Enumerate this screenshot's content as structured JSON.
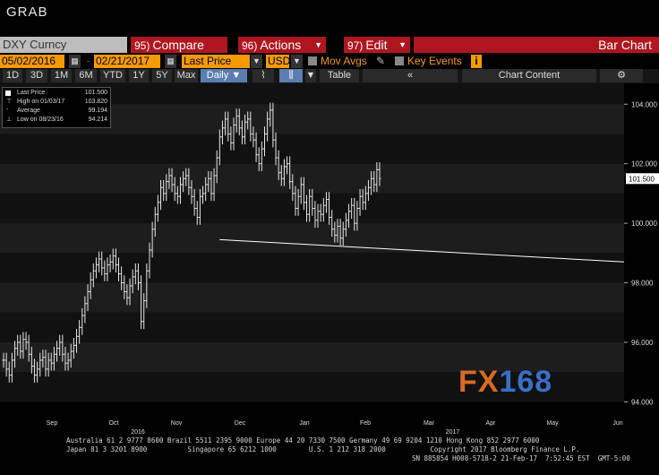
{
  "header": {
    "title": "GRAB"
  },
  "toolbar": {
    "ticker": "DXY Curncy",
    "compare": {
      "num": "95)",
      "label": "Compare"
    },
    "actions": {
      "num": "96)",
      "label": "Actions"
    },
    "edit": {
      "num": "97)",
      "label": "Edit"
    },
    "chart_type": "Bar Chart"
  },
  "settings": {
    "start_date": "05/02/2016",
    "end_date": "02/21/2017",
    "price_field": "Last Price",
    "currency": "USD",
    "mov_avgs": "Mov Avgs",
    "key_events": "Key Events",
    "key_events_icon": "i"
  },
  "periods": [
    "1D",
    "3D",
    "1M",
    "6M",
    "YTD",
    "1Y",
    "5Y",
    "Max"
  ],
  "frequency": "Daily",
  "table_label": "Table",
  "chart_content_label": "Chart Content",
  "legend": {
    "last_price_label": "Last Price",
    "last_price_value": "101.500",
    "high_label": "High on 01/03/17",
    "high_value": "103.820",
    "average_label": "Average",
    "average_value": "99.194",
    "low_label": "Low on 08/23/16",
    "low_value": "94.214"
  },
  "chart_data": {
    "type": "bar",
    "y_ticks": [
      "104.000",
      "102.000",
      "100.000",
      "98.000",
      "96.000",
      "94.000"
    ],
    "y_range": [
      93.5,
      104.7
    ],
    "last_price_tag": "101.500",
    "month_labels": [
      "Sep",
      "Oct",
      "Nov",
      "Dec",
      "Jan",
      "Feb",
      "Mar",
      "Apr",
      "May",
      "Jun"
    ],
    "year_labels": [
      {
        "label": "2016",
        "after": "Oct"
      },
      {
        "label": "2017",
        "after": "Mar"
      }
    ],
    "closes": [
      95.4,
      95.1,
      94.9,
      95.4,
      95.8,
      96.0,
      95.7,
      96.1,
      96.0,
      95.6,
      95.2,
      94.9,
      95.1,
      95.4,
      95.5,
      95.1,
      95.4,
      95.3,
      95.6,
      95.8,
      96.0,
      95.6,
      95.3,
      95.4,
      95.7,
      95.9,
      96.2,
      96.5,
      96.9,
      97.3,
      97.7,
      98.1,
      98.4,
      98.6,
      98.8,
      98.5,
      98.3,
      98.6,
      98.7,
      98.9,
      98.6,
      98.3,
      98.0,
      97.7,
      97.5,
      97.9,
      98.2,
      98.4,
      98.0,
      96.7,
      97.4,
      98.4,
      99.1,
      99.8,
      100.3,
      100.7,
      101.2,
      101.0,
      101.4,
      101.6,
      101.3,
      101.0,
      100.9,
      101.3,
      101.5,
      101.6,
      101.2,
      100.9,
      100.5,
      100.2,
      100.9,
      101.0,
      101.3,
      101.5,
      101.0,
      101.6,
      102.2,
      102.9,
      103.2,
      103.5,
      103.0,
      102.7,
      103.3,
      103.6,
      103.2,
      102.9,
      103.4,
      103.5,
      103.0,
      102.8,
      102.3,
      102.0,
      102.5,
      103.0,
      103.5,
      103.8,
      102.8,
      102.2,
      101.7,
      101.5,
      101.9,
      102.0,
      101.4,
      101.0,
      100.5,
      100.9,
      101.3,
      100.7,
      100.3,
      100.9,
      100.5,
      100.1,
      100.4,
      100.3,
      100.6,
      100.8,
      100.2,
      99.8,
      99.6,
      99.9,
      99.5,
      99.8,
      100.1,
      100.4,
      100.6,
      100.0,
      100.5,
      100.9,
      100.7,
      101.0,
      101.2,
      101.5,
      101.3,
      101.8,
      101.5
    ],
    "trendline": {
      "from_index": 77,
      "from_value": 99.45,
      "to_value": 98.7
    },
    "watermark": {
      "part1": "FX",
      "part2": "168"
    }
  },
  "footer": {
    "line1": "Australia 61 2 9777 8600 Brazil 5511 2395 9000 Europe 44 20 7330 7500 Germany 49 69 9204 1210 Hong Kong 852 2977 6000",
    "line2": "Japan 81 3 3201 8900          Singapore 65 6212 1000        U.S. 1 212 318 2000           Copyright 2017 Bloomberg Finance L.P.",
    "line3": "SN 885854 H008-5718-2 21-Feb-17  7:52:45 EST  GMT-5:00"
  },
  "colors": {
    "bloomberg_red": "#b0161f",
    "bloomberg_orange": "#f59a00",
    "selected_blue": "#5b7db0",
    "wm_fx": "#d86a25",
    "wm_168": "#3a6fc8"
  }
}
